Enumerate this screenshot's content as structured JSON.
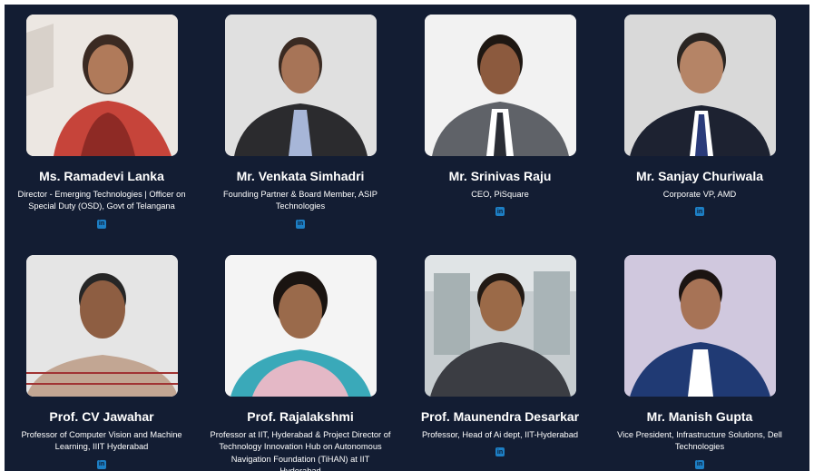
{
  "people": [
    {
      "name": "Ms. Ramadevi Lanka",
      "role": "Director - Emerging Technologies | Officer on Special Duty (OSD), Govt of Telangana",
      "social_icon": "linkedin-icon"
    },
    {
      "name": "Mr. Venkata Simhadri",
      "role": "Founding Partner & Board Member, ASIP Technologies",
      "social_icon": "linkedin-icon"
    },
    {
      "name": "Mr. Srinivas Raju",
      "role": "CEO, PiSquare",
      "social_icon": "linkedin-icon"
    },
    {
      "name": "Mr. Sanjay Churiwala",
      "role": "Corporate VP, AMD",
      "social_icon": "linkedin-icon"
    },
    {
      "name": "Prof. CV Jawahar",
      "role": "Professor of Computer Vision and Machine Learning, IIIT Hyderabad",
      "social_icon": "linkedin-icon"
    },
    {
      "name": "Prof. Rajalakshmi",
      "role": "Professor at IIT, Hyderabad & Project Director of Technology Innovation Hub on Autonomous Navigation Foundation (TiHAN) at IIT Hyderabad",
      "social_icon": "linkedin-icon"
    },
    {
      "name": "Prof. Maunendra Desarkar",
      "role": "Professor, Head of Ai dept, IIT-Hyderabad",
      "social_icon": "linkedin-icon"
    },
    {
      "name": "Mr. Manish Gupta",
      "role": "Vice President, Infrastructure Solutions, Dell Technologies",
      "social_icon": "linkedin-icon"
    }
  ],
  "linkedin_glyph": "in",
  "colors": {
    "background": "#131d33",
    "text": "#ffffff",
    "linkedin": "#1d7fc5"
  }
}
